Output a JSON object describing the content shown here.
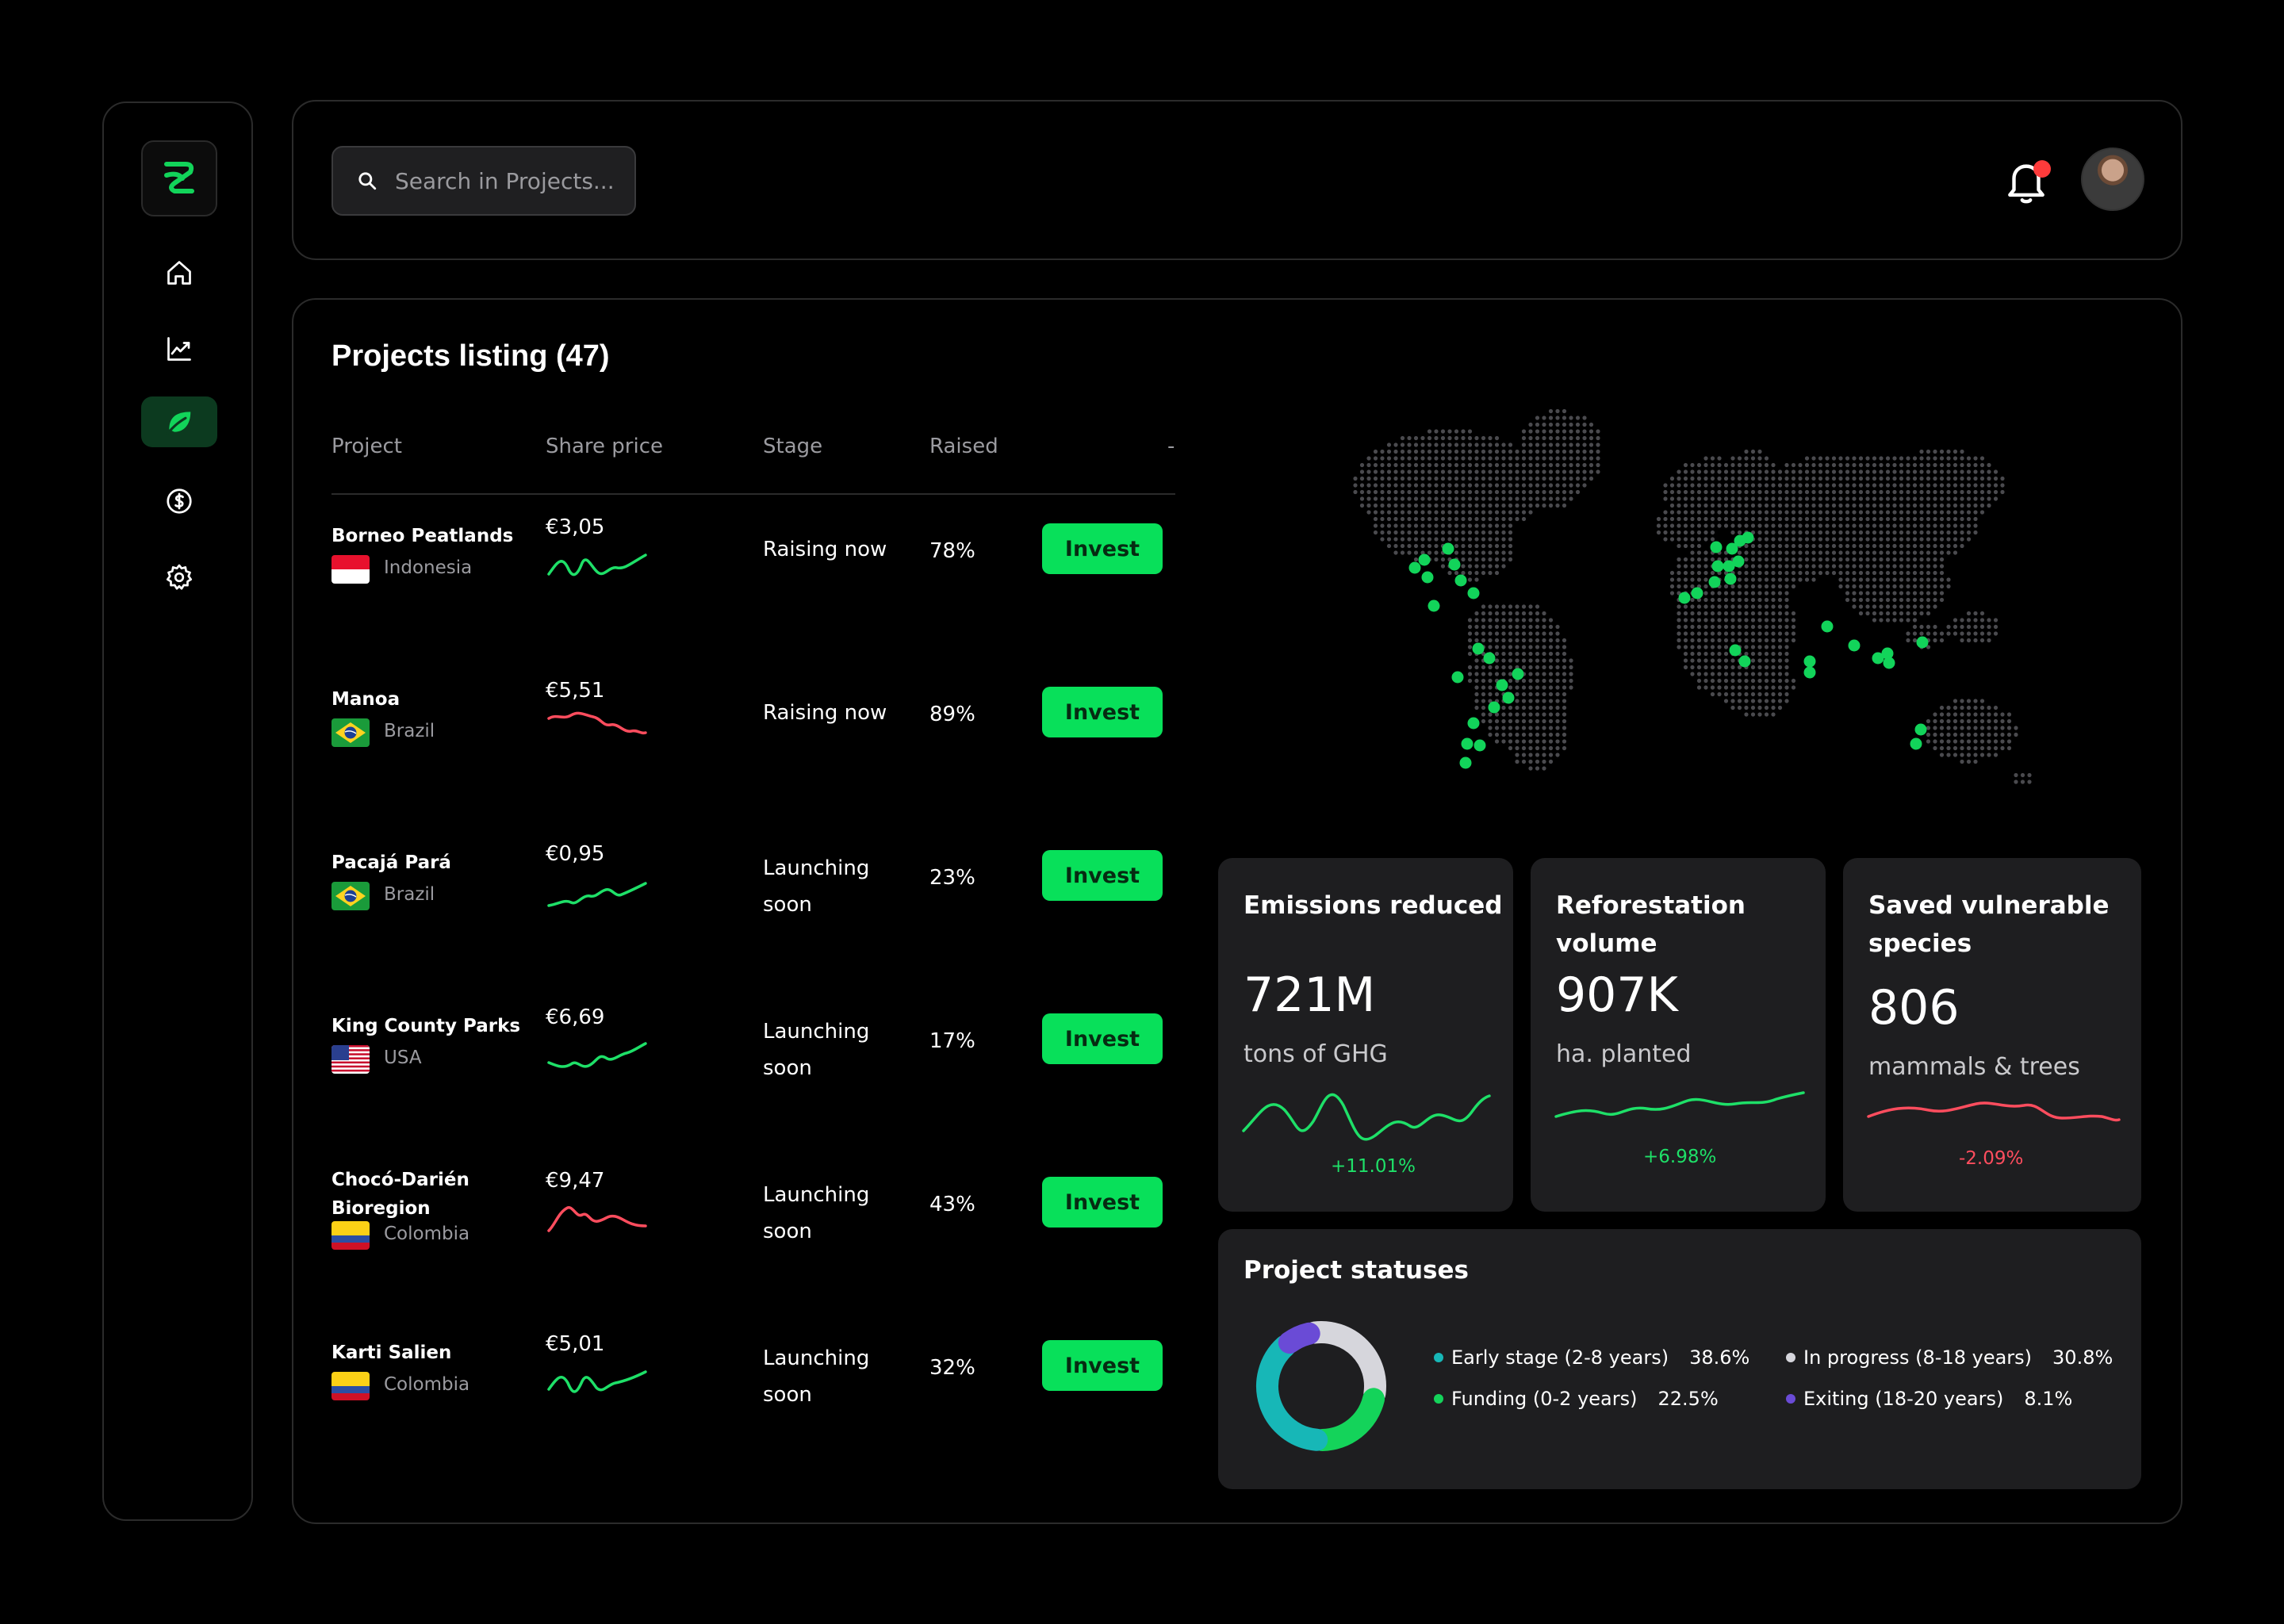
{
  "search": {
    "placeholder": "Search in Projects..."
  },
  "sidebar": {
    "logo": "logo-icon",
    "items": [
      {
        "icon": "home-icon",
        "active": false
      },
      {
        "icon": "chart-icon",
        "active": false
      },
      {
        "icon": "leaf-icon",
        "active": true
      },
      {
        "icon": "dollar-icon",
        "active": false
      },
      {
        "icon": "gear-icon",
        "active": false
      }
    ]
  },
  "listing": {
    "title": "Projects listing (47)",
    "columns": {
      "project": "Project",
      "share_price": "Share price",
      "stage": "Stage",
      "raised": "Raised",
      "extra": "-"
    },
    "invest_label": "Invest",
    "rows": [
      {
        "name": "Borneo Peatlands",
        "country": "Indonesia",
        "flag": "indonesia",
        "price": "€3,05",
        "trend": "up",
        "stage": "Raising now",
        "raised": "78%"
      },
      {
        "name": "Manoa",
        "country": "Brazil",
        "flag": "brazil",
        "price": "€5,51",
        "trend": "down",
        "stage": "Raising now",
        "raised": "89%"
      },
      {
        "name": "Pacajá Pará",
        "country": "Brazil",
        "flag": "brazil",
        "price": "€0,95",
        "trend": "up",
        "stage": "Launching soon",
        "raised": "23%"
      },
      {
        "name": "King County Parks",
        "country": "USA",
        "flag": "usa",
        "price": "€6,69",
        "trend": "up",
        "stage": "Launching soon",
        "raised": "17%"
      },
      {
        "name": "Chocó-Darién Bioregion",
        "country": "Colombia",
        "flag": "colombia",
        "price": "€9,47",
        "trend": "down",
        "stage": "Launching soon",
        "raised": "43%"
      },
      {
        "name": "Karti Salien",
        "country": "Colombia",
        "flag": "colombia",
        "price": "€5,01",
        "trend": "up",
        "stage": "Launching soon",
        "raised": "32%"
      }
    ]
  },
  "stats": [
    {
      "title": "Emissions reduced",
      "value": "721M",
      "unit": "tons of GHG",
      "change": "+11.01%",
      "color": "#1ee068"
    },
    {
      "title": "Reforestation volume",
      "value": "907K",
      "unit": "ha. planted",
      "change": "+6.98%",
      "color": "#1ee068"
    },
    {
      "title": "Saved vulnerable species",
      "value": "806",
      "unit": "mammals & trees",
      "change": "-2.09%",
      "color": "#ff4d5e"
    }
  ],
  "statuses": {
    "title": "Project statuses",
    "items": [
      {
        "label": "Early stage (2-8 years)",
        "value": "38.6%",
        "color": "#17b7b7"
      },
      {
        "label": "In progress (8-18 years)",
        "value": "30.8%",
        "color": "#d6d6dc"
      },
      {
        "label": "Funding (0-2 years)",
        "value": "22.5%",
        "color": "#14d35a"
      },
      {
        "label": "Exiting (18-20 years)",
        "value": "8.1%",
        "color": "#6a4bd6"
      }
    ]
  },
  "colors": {
    "accent": "#08e05a",
    "negative": "#ff4d5e",
    "notification": "#ff3b3b"
  }
}
